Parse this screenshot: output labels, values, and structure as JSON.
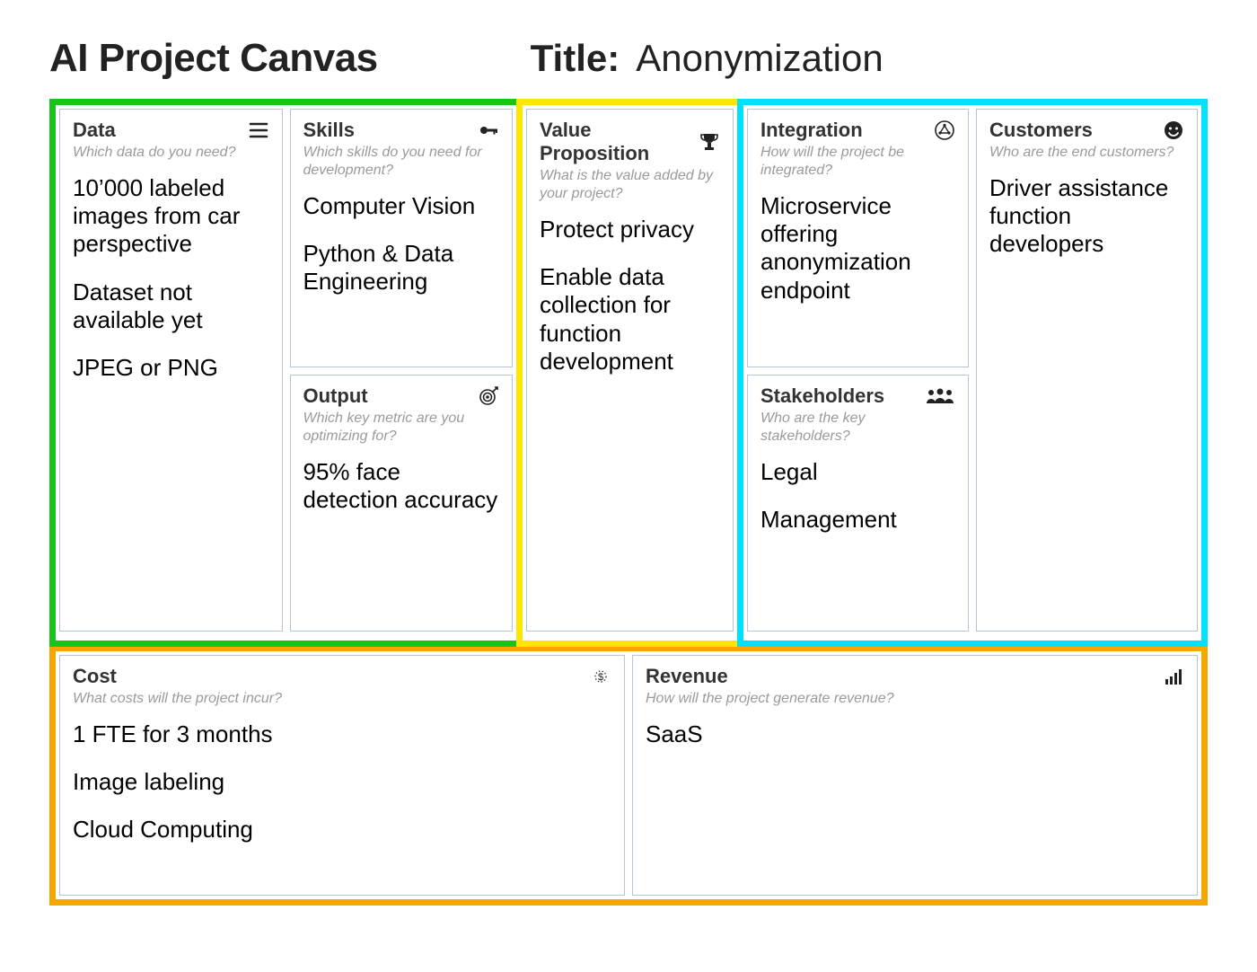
{
  "header": {
    "canvas_label": "AI Project Canvas",
    "title_label": "Title:",
    "title_value": "Anonymization"
  },
  "frame_colors": {
    "green": "#18c41a",
    "yellow": "#ffe600",
    "cyan": "#00e0ff",
    "orange": "#f7a600"
  },
  "cells": {
    "data": {
      "title": "Data",
      "sub": "Which data do you need?",
      "icon": "menu-icon",
      "body": [
        "10’000 labeled images from car perspective",
        "Dataset not available yet",
        "JPEG or PNG"
      ]
    },
    "skills": {
      "title": "Skills",
      "sub": "Which skills do you need for development?",
      "icon": "key-icon",
      "body": [
        "Computer Vision",
        "Python & Data Engineering"
      ]
    },
    "output": {
      "title": "Output",
      "sub": "Which key metric are you optimizing for?",
      "icon": "target-icon",
      "body": [
        "95% face detection accuracy"
      ]
    },
    "value": {
      "title": "Value Proposition",
      "sub": "What is the value added by your project?",
      "icon": "trophy-icon",
      "body": [
        "Protect privacy",
        "Enable data collection for function development"
      ]
    },
    "integration": {
      "title": "Integration",
      "sub": "How will the project be integrated?",
      "icon": "network-icon",
      "body": [
        "Microservice offering anonymization endpoint"
      ]
    },
    "stakeholders": {
      "title": "Stakeholders",
      "sub": "Who are the key stakeholders?",
      "icon": "people-icon",
      "body": [
        "Legal",
        "Management"
      ]
    },
    "customers": {
      "title": "Customers",
      "sub": "Who are the end customers?",
      "icon": "smile-icon",
      "body": [
        "Driver assistance function developers"
      ]
    },
    "cost": {
      "title": "Cost",
      "sub": "What costs will the project incur?",
      "icon": "dollar-icon",
      "body": [
        "1 FTE for 3 months",
        "Image labeling",
        "Cloud Computing"
      ]
    },
    "revenue": {
      "title": "Revenue",
      "sub": "How will the project generate revenue?",
      "icon": "chart-icon",
      "body": [
        "SaaS"
      ]
    }
  }
}
